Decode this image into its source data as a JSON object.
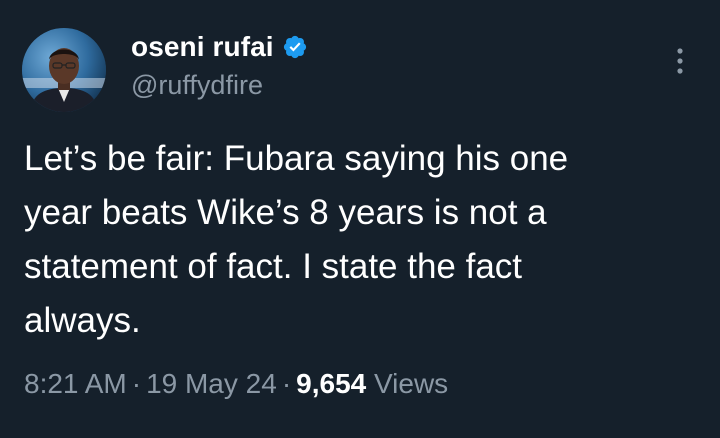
{
  "user": {
    "display_name": "oseni rufai",
    "handle": "@ruffydfire",
    "verified": true,
    "avatar_icon": "profile-photo"
  },
  "tweet": {
    "text": "Let’s be fair: Fubara saying his one\nyear beats Wike’s 8 years is not a\nstatement of fact. I state the fact\nalways."
  },
  "meta": {
    "time": "8:21 AM",
    "separator": "·",
    "date": "19 May 24",
    "views_count": "9,654",
    "views_label": "Views"
  },
  "colors": {
    "background": "#15202b",
    "primary_text": "#ffffff",
    "secondary_text": "#8b98a5",
    "verified_badge": "#1d9bf0"
  },
  "icons": {
    "more": "more-vertical-icon",
    "verified": "verified-badge-icon"
  }
}
